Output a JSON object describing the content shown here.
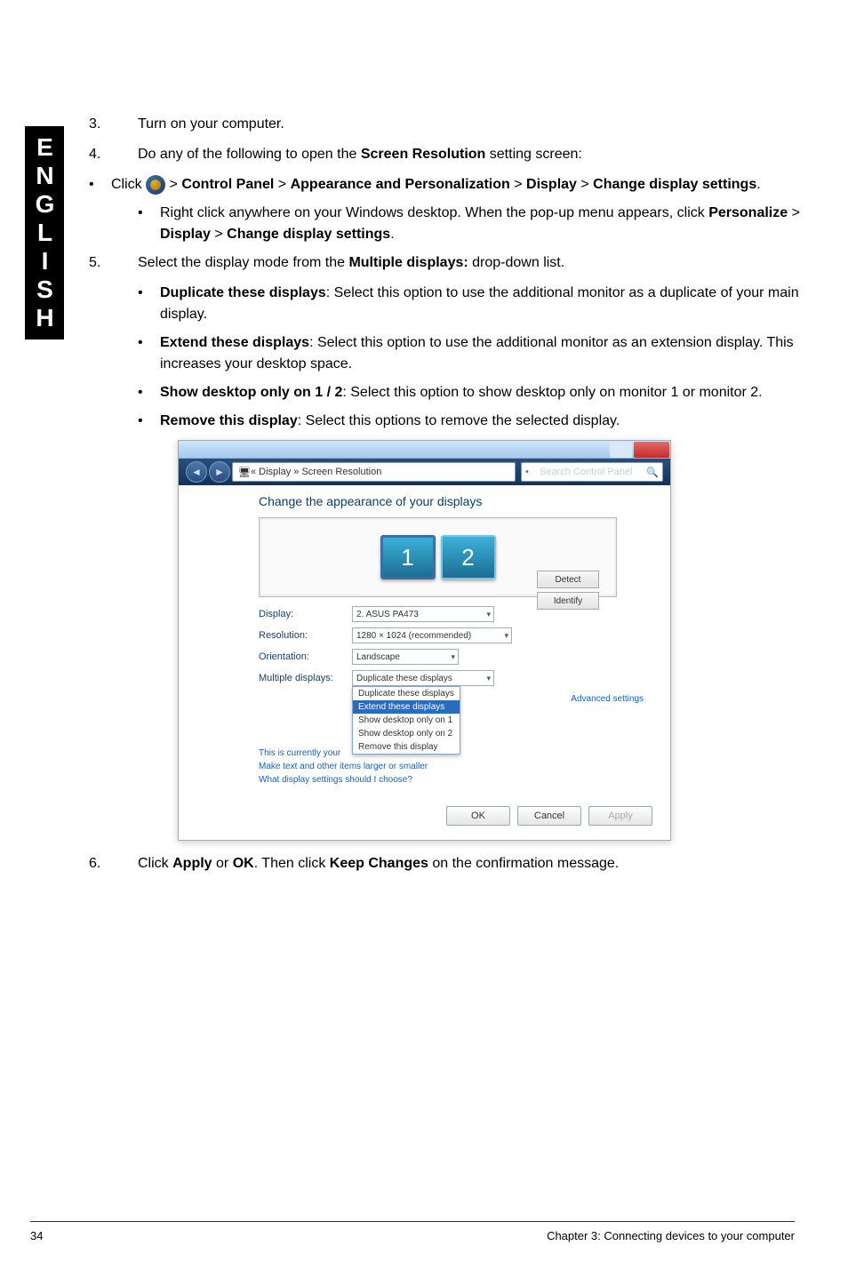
{
  "sidebar_label": "ENGLISH",
  "steps": {
    "s3": {
      "num": "3.",
      "text": "Turn on your computer."
    },
    "s4": {
      "num": "4.",
      "text_prefix": "Do any of the following to open the ",
      "bold": "Screen Resolution",
      "text_suffix": " setting screen:"
    },
    "click_path": {
      "click": "Click ",
      "p1": "Control Panel",
      "p2": "Appearance and Personalization",
      "p3": "Display",
      "p4": "Change display settings",
      "period": "."
    },
    "rightclick": {
      "pre": "Right click anywhere on your Windows desktop. When the pop-up menu appears, click ",
      "b1": "Personalize",
      "b2": "Display",
      "b3": "Change display settings",
      "period": "."
    },
    "s5": {
      "num": "5.",
      "pre": "Select the display mode from the ",
      "bold": "Multiple displays:",
      "suf": " drop-down list."
    },
    "opt1": {
      "b": "Duplicate these displays",
      "t": ": Select this option to use the additional monitor as a duplicate of your main display."
    },
    "opt2": {
      "b": "Extend these displays",
      "t": ": Select this option to use the additional monitor as an extension display. This increases your desktop space."
    },
    "opt3": {
      "b": "Show desktop only on 1 / 2",
      "t": ": Select this option to show desktop only on monitor 1 or monitor 2."
    },
    "opt4": {
      "b": "Remove this display",
      "t": ": Select this options to remove the selected display."
    },
    "s6": {
      "num": "6.",
      "t1": "Click ",
      "b1": "Apply",
      "t2": " or ",
      "b2": "OK",
      "t3": ". Then click ",
      "b3": "Keep Changes",
      "t4": " on the confirmation message."
    }
  },
  "window": {
    "breadcrumb_icon": "🖥",
    "breadcrumb": " « Display » Screen Resolution",
    "search_placeholder": "Search Control Panel",
    "heading": "Change the appearance of your displays",
    "monitor1": "1",
    "monitor2": "2",
    "btn_detect": "Detect",
    "btn_identify": "Identify",
    "labels": {
      "display": "Display:",
      "resolution": "Resolution:",
      "orientation": "Orientation:",
      "multiple": "Multiple displays:"
    },
    "values": {
      "display": "2. ASUS PA473",
      "resolution": "1280 × 1024 (recommended)",
      "orientation": "Landscape",
      "multiple": "Duplicate these displays"
    },
    "dropdown": {
      "i0": "Duplicate these displays",
      "i1": "Extend these displays",
      "i2": "Show desktop only on 1",
      "i3": "Show desktop only on 2",
      "i4": "Remove this display"
    },
    "link1_pre": "This is currently your ",
    "link2_pre": "Make text and other items larger or smaller",
    "link3": "What display settings should I choose?",
    "advanced": "Advanced settings",
    "ok": "OK",
    "cancel": "Cancel",
    "apply": "Apply"
  },
  "footer": {
    "page": "34",
    "chapter": "Chapter 3: Connecting devices to your computer"
  }
}
